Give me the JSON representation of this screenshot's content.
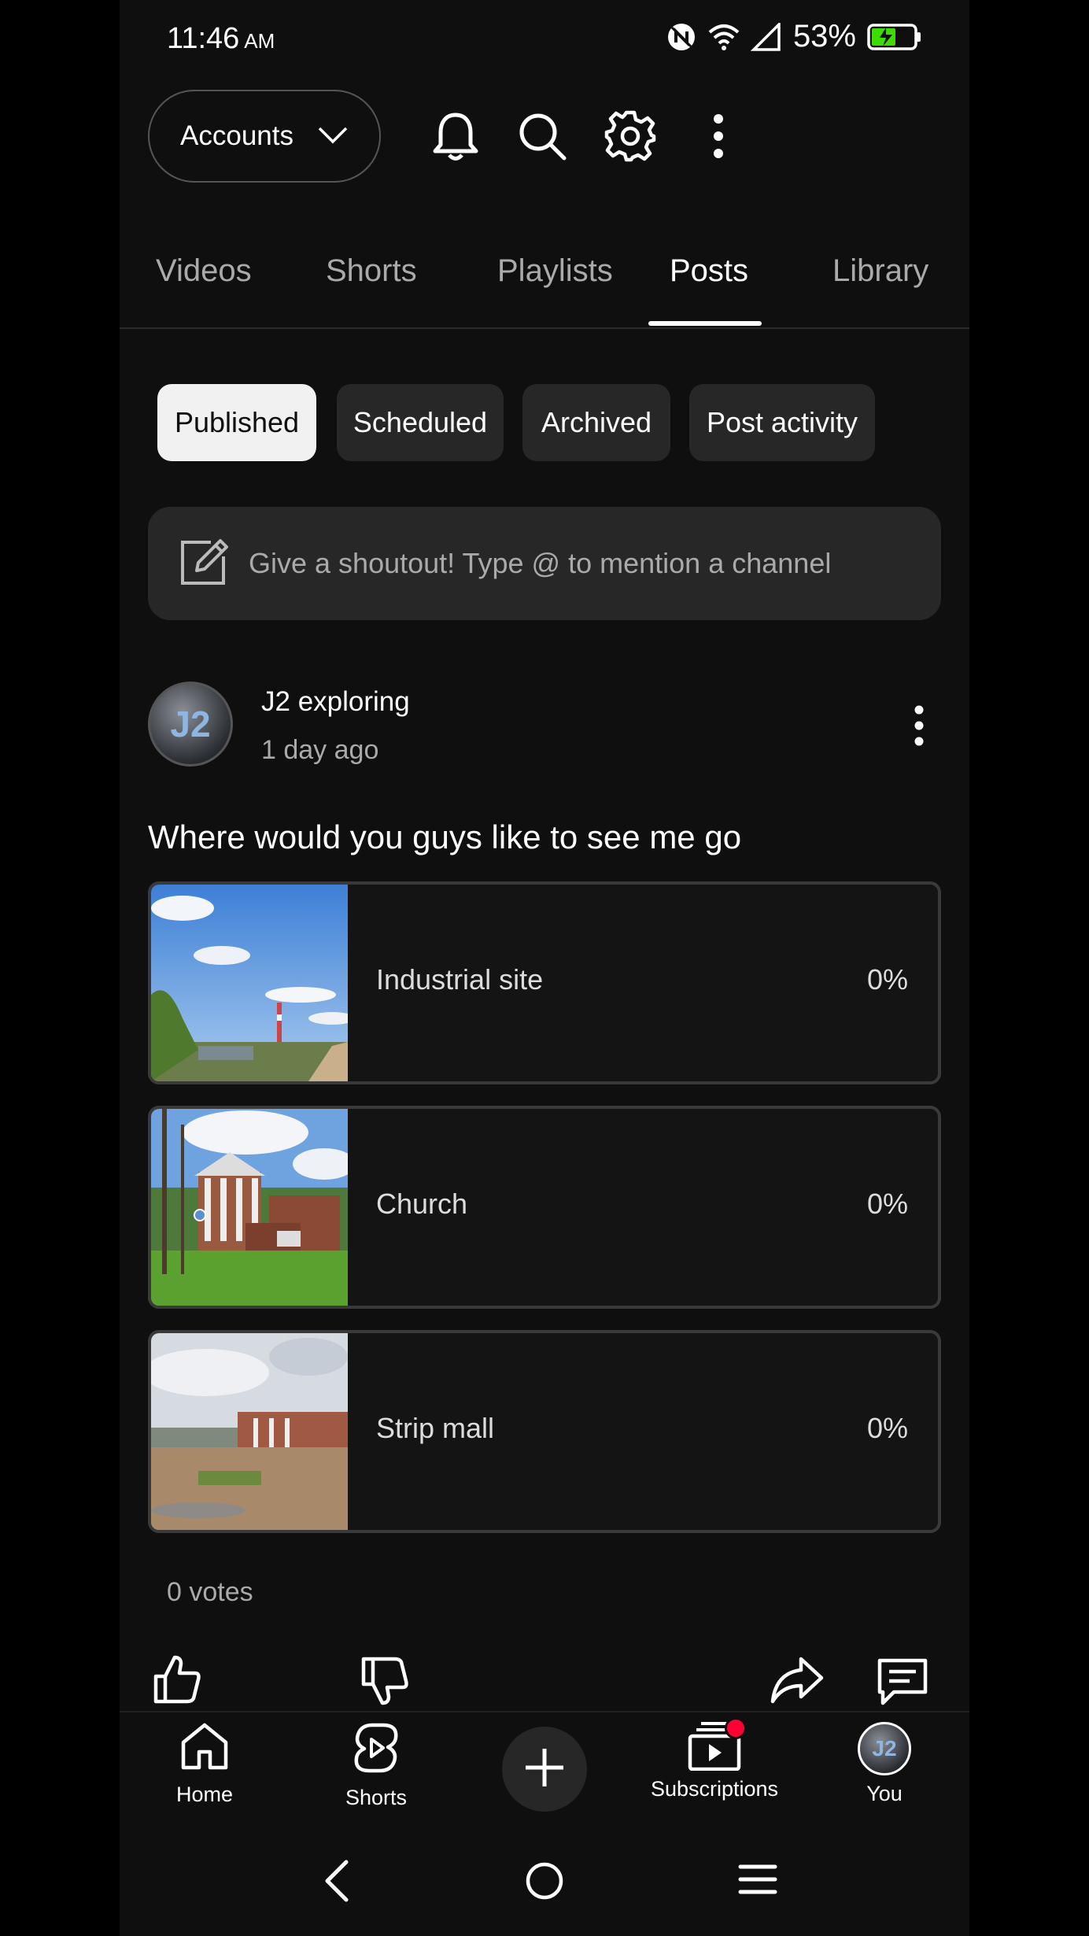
{
  "status_bar": {
    "time": "11:46",
    "ampm": "AM",
    "battery": "53%"
  },
  "header": {
    "accounts_label": "Accounts"
  },
  "tabs": [
    {
      "label": "Videos",
      "active": false
    },
    {
      "label": "Shorts",
      "active": false
    },
    {
      "label": "Playlists",
      "active": false
    },
    {
      "label": "Posts",
      "active": true
    },
    {
      "label": "Library",
      "active": false
    }
  ],
  "chips": [
    {
      "label": "Published",
      "selected": true
    },
    {
      "label": "Scheduled",
      "selected": false
    },
    {
      "label": "Archived",
      "selected": false
    },
    {
      "label": "Post activity",
      "selected": false
    }
  ],
  "shoutout": {
    "placeholder": "Give a shoutout! Type @ to mention a channel"
  },
  "post": {
    "avatar_text": "J2",
    "channel_name": "J2 exploring",
    "time_ago": "1 day ago",
    "question": "Where would you guys like to see me go",
    "options": [
      {
        "label": "Industrial site",
        "percent": "0%"
      },
      {
        "label": "Church",
        "percent": "0%"
      },
      {
        "label": "Strip mall",
        "percent": "0%"
      }
    ],
    "votes": "0 votes"
  },
  "bottom_nav": {
    "home": "Home",
    "shorts": "Shorts",
    "subscriptions": "Subscriptions",
    "you": "You",
    "you_avatar_text": "J2"
  },
  "colors": {
    "background": "#0f0f0f",
    "chip": "#272727",
    "notification_dot": "#ff0033",
    "battery_charge": "#3ddc00"
  }
}
